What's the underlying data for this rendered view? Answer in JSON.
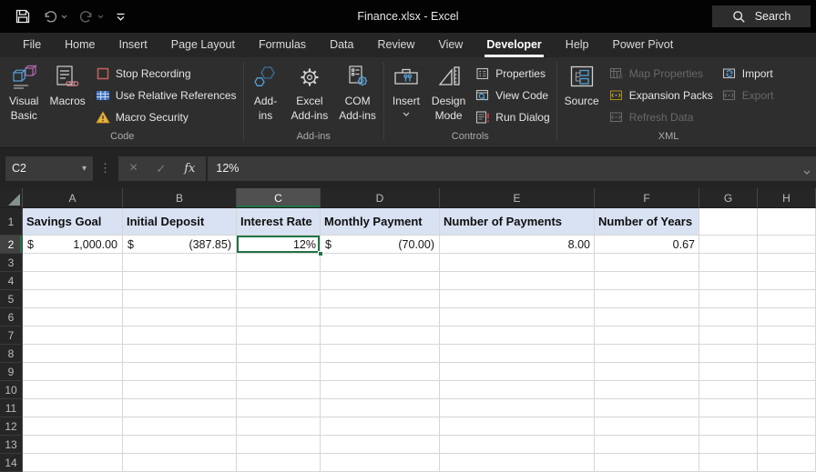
{
  "titlebar": {
    "title": "Finance.xlsx  -  Excel",
    "search_label": "Search"
  },
  "tabs": [
    {
      "label": "File"
    },
    {
      "label": "Home"
    },
    {
      "label": "Insert"
    },
    {
      "label": "Page Layout"
    },
    {
      "label": "Formulas"
    },
    {
      "label": "Data"
    },
    {
      "label": "Review"
    },
    {
      "label": "View"
    },
    {
      "label": "Developer",
      "active": true
    },
    {
      "label": "Help"
    },
    {
      "label": "Power Pivot"
    }
  ],
  "ribbon": {
    "code": {
      "label": "Code",
      "visual_basic": "Visual\nBasic",
      "macros": "Macros",
      "stop_recording": "Stop Recording",
      "use_relative_references": "Use Relative References",
      "macro_security": "Macro Security"
    },
    "addins": {
      "label": "Add-ins",
      "addins": "Add-\nins",
      "excel_addins": "Excel\nAdd-ins",
      "com_addins": "COM\nAdd-ins"
    },
    "controls": {
      "label": "Controls",
      "insert": "Insert",
      "design_mode": "Design\nMode",
      "properties": "Properties",
      "view_code": "View Code",
      "run_dialog": "Run Dialog"
    },
    "xml": {
      "label": "XML",
      "source": "Source",
      "map_properties": "Map Properties",
      "expansion_packs": "Expansion Packs",
      "refresh_data": "Refresh Data",
      "import": "Import",
      "export": "Export"
    }
  },
  "formula_bar": {
    "name_box": "C2",
    "formula": "12%",
    "fx": "fx"
  },
  "icons": {
    "dropdown": "▾",
    "drag_dots": "⋮",
    "cancel": "×",
    "enter": "✓"
  },
  "grid": {
    "column_letters": [
      "A",
      "B",
      "C",
      "D",
      "E",
      "F",
      "G",
      "H"
    ],
    "row_numbers": [
      "1",
      "2",
      "3",
      "4",
      "5",
      "6",
      "7",
      "8",
      "9",
      "10",
      "11",
      "12",
      "13",
      "14"
    ],
    "selected_cell": "C2",
    "row1": [
      "Savings Goal",
      "Initial Deposit",
      "Interest Rate",
      "Monthly Payment",
      "Number of Payments",
      "Number of Years",
      "",
      ""
    ],
    "row2": [
      {
        "prefix": "$",
        "value": "1,000.00"
      },
      {
        "prefix": "$",
        "value": "(387.85)"
      },
      {
        "prefix": "",
        "value": "12%"
      },
      {
        "prefix": "$",
        "value": "(70.00)"
      },
      {
        "prefix": "",
        "value": "8.00"
      },
      {
        "prefix": "",
        "value": "0.67"
      },
      {
        "prefix": "",
        "value": ""
      },
      {
        "prefix": "",
        "value": ""
      }
    ],
    "colors": {
      "selection_green": "#217346",
      "header_fill": "#d9e2f3"
    }
  }
}
